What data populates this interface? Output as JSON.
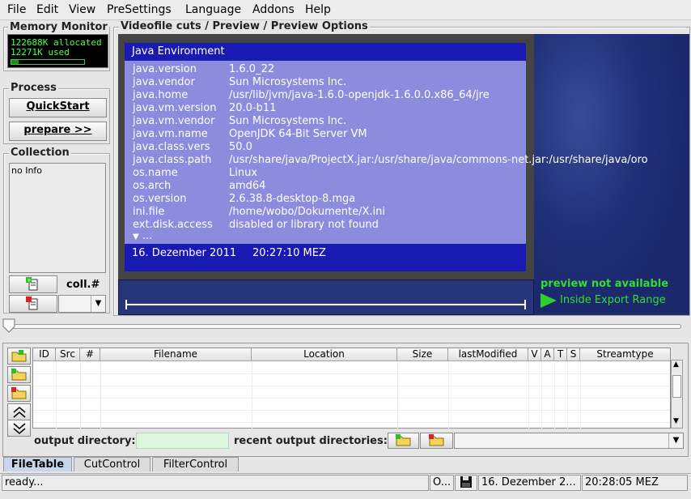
{
  "menu": [
    "File",
    "Edit",
    "View",
    "PreSettings",
    "Language",
    "Addons",
    "Help"
  ],
  "memory": {
    "title": "Memory Monitor",
    "allocated": "122688K allocated",
    "used": "12271K used",
    "used_fraction": 0.1
  },
  "process": {
    "title": "Process",
    "quickstart": "QuickStart",
    "prepare": "prepare >>"
  },
  "collection": {
    "title": "Collection",
    "info": "no Info",
    "coll_label": "coll.#"
  },
  "videofile": {
    "title": "Videofile cuts / Preview / Preview Options"
  },
  "java": {
    "title": "Java Environment",
    "rows": [
      {
        "k": "java.version",
        "v": "1.6.0_22"
      },
      {
        "k": "java.vendor",
        "v": "Sun Microsystems Inc."
      },
      {
        "k": "java.home",
        "v": "/usr/lib/jvm/java-1.6.0-openjdk-1.6.0.0.x86_64/jre"
      },
      {
        "k": "java.vm.version",
        "v": "20.0-b11"
      },
      {
        "k": "java.vm.vendor",
        "v": "Sun Microsystems Inc."
      },
      {
        "k": "java.vm.name",
        "v": "OpenJDK 64-Bit Server VM"
      },
      {
        "k": "java.class.vers",
        "v": "50.0"
      },
      {
        "k": "java.class.path",
        "v": "/usr/share/java/ProjectX.jar:/usr/share/java/commons-net.jar:/usr/share/java/oro"
      },
      {
        "k": "os.name",
        "v": "Linux"
      },
      {
        "k": "os.arch",
        "v": "amd64"
      },
      {
        "k": "os.version",
        "v": "2.6.38.8-desktop-8.mga"
      },
      {
        "k": "ini.file",
        "v": "/home/wobo/Dokumente/X.ini"
      },
      {
        "k": "ext.disk.access",
        "v": "disabled or library not found"
      }
    ],
    "more": "...",
    "date": "16. Dezember 2011",
    "time": "20:27:10 MEZ"
  },
  "preview": {
    "not_available": "preview not available",
    "inside": "Inside Export Range"
  },
  "table": {
    "columns": [
      "ID",
      "Src",
      "#",
      "Filename",
      "Location",
      "Size",
      "lastModified",
      "V",
      "A",
      "T",
      "S",
      "Streamtype"
    ]
  },
  "output": {
    "dir_label": "output directory:",
    "recent_label": "recent output directories:",
    "dir_value": ""
  },
  "tabs": [
    "FileTable",
    "CutControl",
    "FilterControl"
  ],
  "status": {
    "text": "ready...",
    "o": "O...",
    "date": "16. Dezember 2...",
    "time": "20:28:05 MEZ"
  },
  "colors": {
    "java_title": "#1919b3",
    "java_body": "#8c8cdf",
    "preview_green": "#33dd33"
  }
}
